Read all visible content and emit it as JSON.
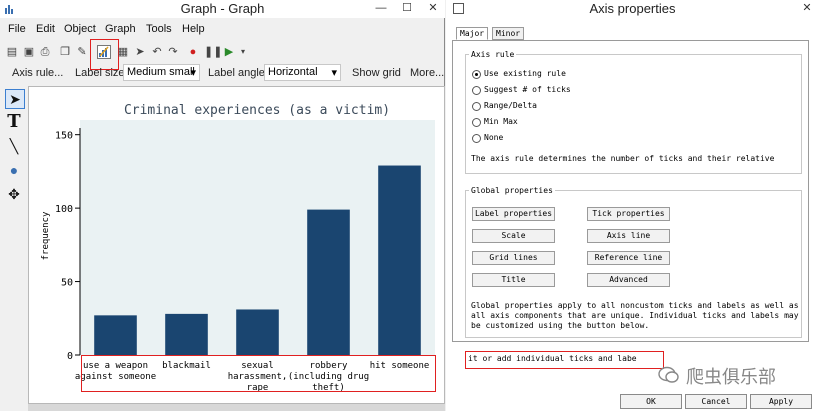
{
  "graph_window": {
    "title": "Graph - Graph",
    "menu": [
      "File",
      "Edit",
      "Object",
      "Graph",
      "Tools",
      "Help"
    ],
    "props": {
      "axis_rule_label": "Axis rule...",
      "label_size_label": "Label size:",
      "label_size_value": "Medium small",
      "label_angle_label": "Label angle:",
      "label_angle_value": "Horizontal",
      "show_grid": "Show grid",
      "more": "More..."
    }
  },
  "chart_data": {
    "type": "bar",
    "title": "Criminal experiences (as a victim)",
    "ylabel": "frequency",
    "xlabel": "",
    "ylim": [
      0,
      160
    ],
    "yticks": [
      0,
      50,
      100,
      150
    ],
    "categories": [
      [
        "use a weapon",
        "against someone"
      ],
      [
        "blackmail"
      ],
      [
        "sexual",
        "harassment,",
        "rape"
      ],
      [
        "robbery",
        "(including drug",
        "theft)"
      ],
      [
        "hit someone"
      ]
    ],
    "values": [
      27,
      28,
      31,
      99,
      129
    ],
    "bar_color": "#1a4570",
    "grid": false
  },
  "axis_window": {
    "title": "Axis properties",
    "tabs": [
      "Major",
      "Minor"
    ],
    "axis_rule": {
      "group_title": "Axis rule",
      "options": [
        "Use existing rule",
        "Suggest # of ticks",
        "Range/Delta",
        "Min Max",
        "None"
      ],
      "selected": 0,
      "description": "The axis rule determines the number of ticks and their relative"
    },
    "global": {
      "group_title": "Global properties",
      "buttons": [
        "Label properties",
        "Tick properties",
        "Scale",
        "Axis line",
        "Grid lines",
        "Reference line",
        "Title",
        "Advanced"
      ],
      "note": [
        "Global properties apply to all noncustom ticks and labels as well as",
        "all axis components that are unique. Individual ticks and labels may",
        "be customized using the button below."
      ]
    },
    "edit_input_value": "it or add individual ticks and labe",
    "footer": [
      "OK",
      "Cancel",
      "Apply"
    ]
  },
  "watermark": "爬虫俱乐部",
  "colors": {
    "accent": "#1a4570",
    "highlight": "#e02020",
    "plot_bg": "#eaf2f3"
  }
}
